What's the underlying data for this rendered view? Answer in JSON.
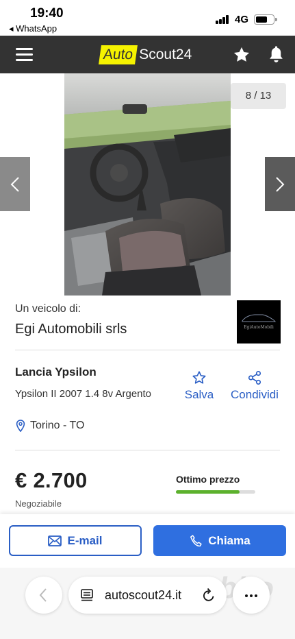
{
  "status_bar": {
    "time": "19:40",
    "back_app": "◂ WhatsApp",
    "network": "4G"
  },
  "header": {
    "logo_auto": "Auto",
    "logo_scout": "Scout24",
    "menu_icon": "hamburger-icon",
    "favorites_icon": "star-icon",
    "notifications_icon": "bell-icon"
  },
  "gallery": {
    "counter": "8 / 13",
    "prev_icon": "chevron-left-icon",
    "next_icon": "chevron-right-icon"
  },
  "dealer": {
    "label": "Un veicolo di:",
    "name": "Egi Automobili srls",
    "logo_text": "EgiAutoMobili"
  },
  "vehicle": {
    "make_model": "Lancia Ypsilon",
    "version": "Ypsilon II 2007 1.4 8v Argento",
    "save_label": "Salva",
    "share_label": "Condividi",
    "location": "Torino - TO"
  },
  "price": {
    "amount": "€ 2.700",
    "negotiable": "Negoziabile",
    "rating_label": "Ottimo prezzo",
    "rating_level": 0.8
  },
  "contact": {
    "email_label": "E-mail",
    "call_label": "Chiama"
  },
  "browser": {
    "url": "autoscout24.it"
  },
  "colors": {
    "header_bg": "#333333",
    "logo_yellow": "#f5f200",
    "accent_blue": "#2a5ec5",
    "call_blue": "#2f6fe0",
    "rating_green": "#5cb12d"
  }
}
